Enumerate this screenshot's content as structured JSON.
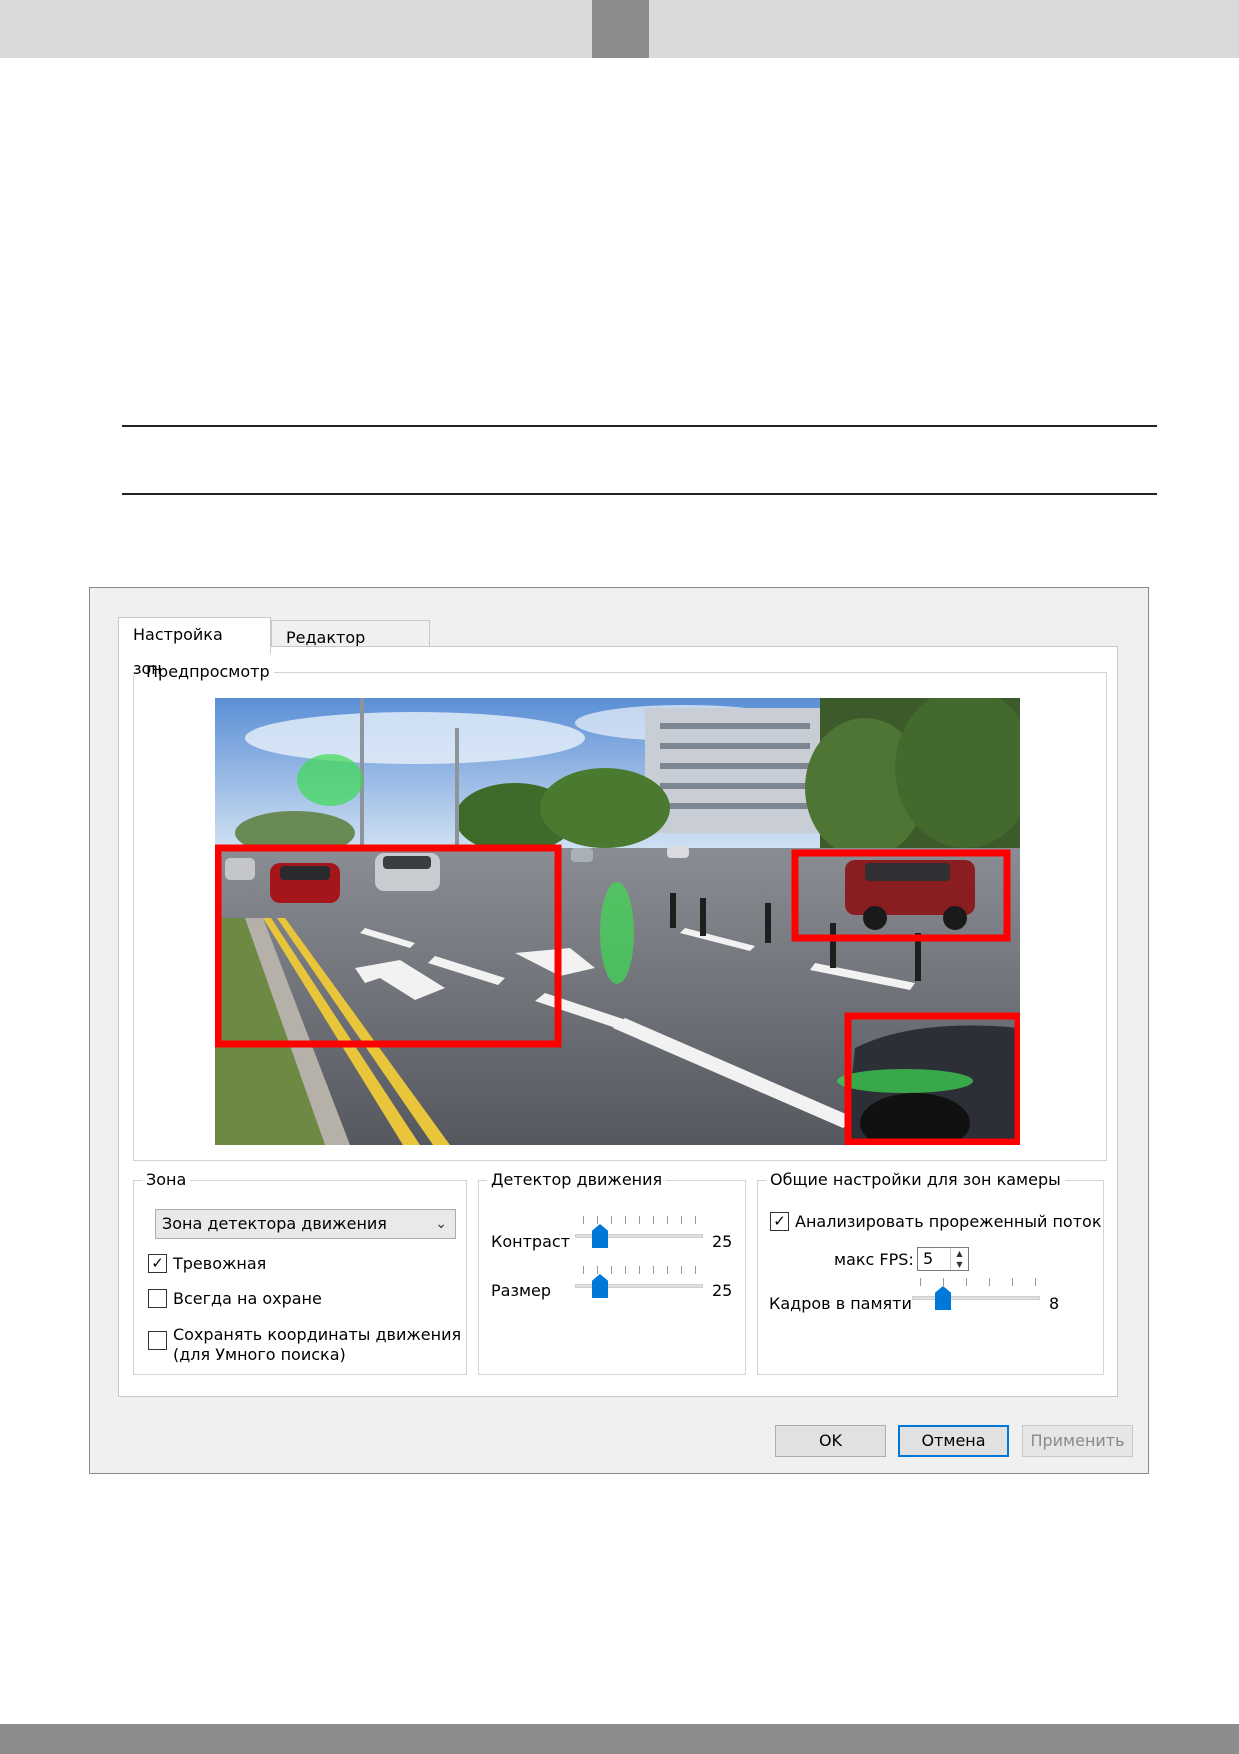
{
  "tabs": [
    {
      "label": "Настройка зон"
    },
    {
      "label": "Редактор маски"
    }
  ],
  "preview": {
    "title": "Предпросмотр"
  },
  "zone": {
    "title": "Зона",
    "combo_value": "Зона детектора движения",
    "alarm_label": "Тревожная",
    "alarm_checked": true,
    "always_armed_label": "Всегда на охране",
    "always_armed_checked": false,
    "save_coords_line1": "Сохранять координаты движения",
    "save_coords_line2": "(для Умного поиска)",
    "save_coords_checked": false
  },
  "motion": {
    "title": "Детектор движения",
    "contrast_label": "Контраст",
    "contrast_value": "25",
    "size_label": "Размер",
    "size_value": "25"
  },
  "common": {
    "title": "Общие настройки для зон камеры",
    "analyze_label": "Анализировать прореженный поток",
    "analyze_checked": true,
    "fps_label": "макс FPS:",
    "fps_value": "5",
    "frames_label": "Кадров в памяти",
    "frames_value": "8"
  },
  "buttons": {
    "ok": "OK",
    "cancel": "Отмена",
    "apply": "Применить"
  },
  "colors": {
    "zone_frame": "#ff0000",
    "motion_blob": "#3ddc52",
    "slider_thumb": "#0078d7"
  }
}
